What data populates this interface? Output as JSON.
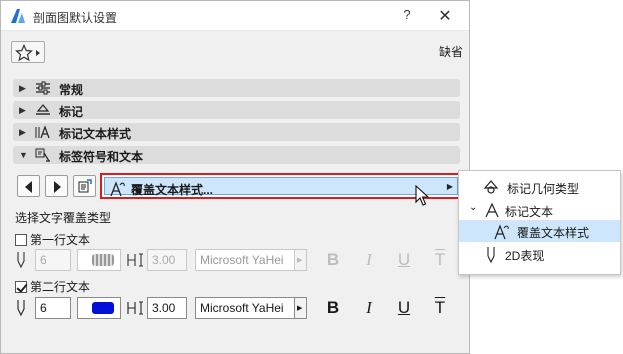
{
  "window": {
    "title": "剖面图默认设置",
    "help_label": "?",
    "close_label": "✕"
  },
  "favorites": {
    "icon": "star-icon"
  },
  "default_label": "缺省",
  "sections": [
    {
      "label": "常规",
      "expanded": false,
      "icon": "general-settings-icon"
    },
    {
      "label": "标记",
      "expanded": false,
      "icon": "marker-icon"
    },
    {
      "label": "标记文本样式",
      "expanded": false,
      "icon": "marker-text-style-icon"
    },
    {
      "label": "标签符号和文本",
      "expanded": true,
      "icon": "label-symbol-icon"
    }
  ],
  "style_selector": {
    "label": "覆盖文本样式...",
    "icon": "text-style-icon"
  },
  "override": {
    "title": "选择文字覆盖类型",
    "rows": [
      {
        "checkbox_label": "第一行文本",
        "checked": false,
        "enabled": false,
        "pen": "6",
        "swatch_color": "#9a9a9a",
        "size": "3.00",
        "font": "Microsoft YaHei",
        "bold": "B",
        "italic": "I",
        "underline": "U",
        "strike": "T"
      },
      {
        "checkbox_label": "第二行文本",
        "checked": true,
        "enabled": true,
        "pen": "6",
        "swatch_color": "#0010d8",
        "size": "3.00",
        "font": "Microsoft YaHei",
        "bold": "B",
        "italic": "I",
        "underline": "U",
        "strike": "T"
      }
    ]
  },
  "popup_menu": {
    "items": [
      {
        "label": "标记几何类型",
        "icon": "marker-geometry-icon"
      },
      {
        "label": "标记文本",
        "icon": "marker-text-icon",
        "expanded": true
      },
      {
        "label": "覆盖文本样式",
        "icon": "text-style-icon",
        "selected": true
      },
      {
        "label": "2D表现",
        "icon": "pen-icon"
      }
    ]
  },
  "colors": {
    "accent_highlight": "#cde6fb",
    "focus_border": "#e01b1b",
    "section_bg": "#dcdcdc"
  }
}
